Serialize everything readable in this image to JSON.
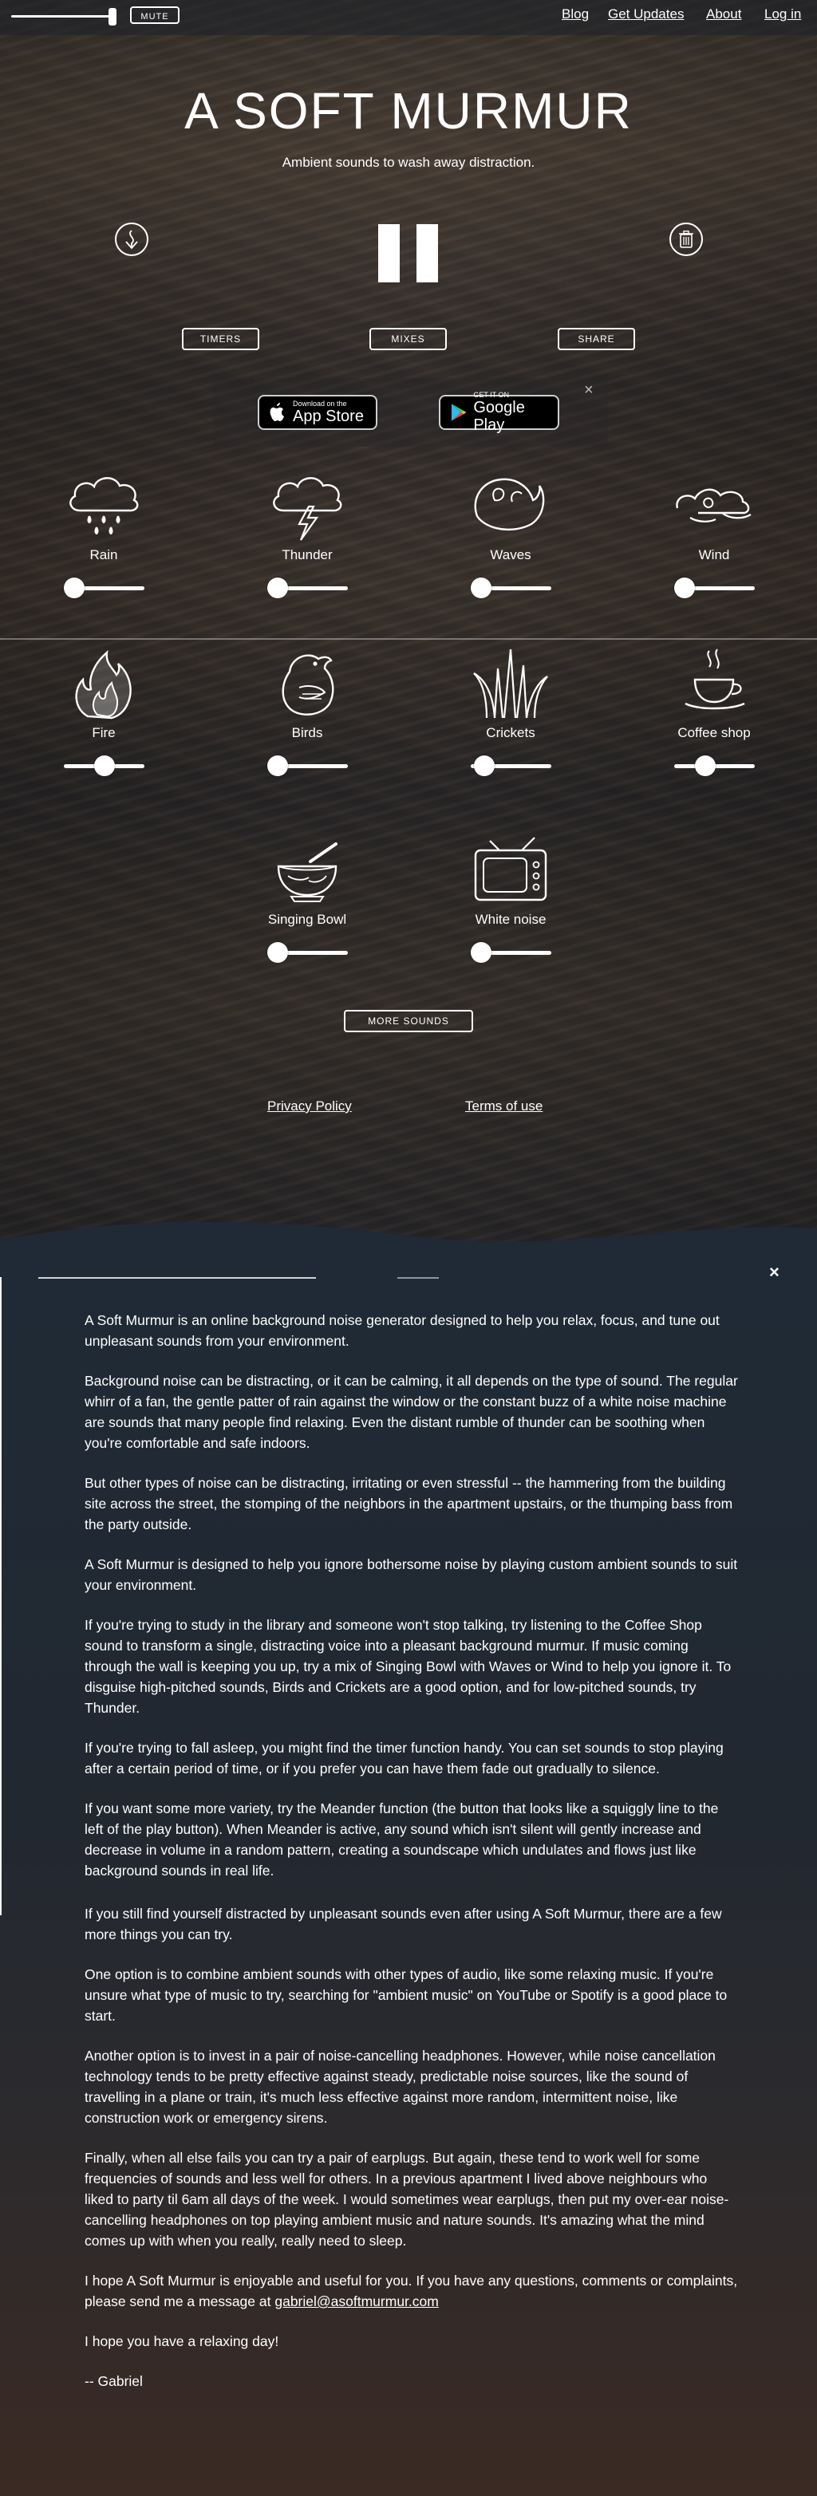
{
  "topbar": {
    "mute_label": "MUTE",
    "nav": [
      "Blog",
      "Get Updates",
      "About",
      "Log in"
    ]
  },
  "hero": {
    "title": "A SOFT MURMUR",
    "subtitle": "Ambient sounds to wash away distraction."
  },
  "controls": {
    "left_icon": "meander-icon",
    "play_state_icon": "pause-icon",
    "right_icon": "trash-icon",
    "buttons": [
      "TIMERS",
      "MIXES",
      "SHARE"
    ]
  },
  "stores": {
    "apple_small": "Download on the",
    "apple_big": "App Store",
    "google_small": "GET IT ON",
    "google_big": "Google Play",
    "close": "×"
  },
  "sounds": [
    {
      "label": "Rain",
      "icon": "rain-cloud-icon",
      "level": 0.0
    },
    {
      "label": "Thunder",
      "icon": "thunder-cloud-icon",
      "level": 0.0
    },
    {
      "label": "Waves",
      "icon": "waves-icon",
      "level": 0.0
    },
    {
      "label": "Wind",
      "icon": "wind-icon",
      "level": 0.0
    },
    {
      "label": "Fire",
      "icon": "fire-icon",
      "level": 0.5
    },
    {
      "label": "Birds",
      "icon": "bird-icon",
      "level": 0.0
    },
    {
      "label": "Crickets",
      "icon": "grass-icon",
      "level": 0.05
    },
    {
      "label": "Coffee shop",
      "icon": "coffee-cup-icon",
      "level": 0.35
    },
    {
      "label": "Singing Bowl",
      "icon": "singing-bowl-icon",
      "level": 0.0
    },
    {
      "label": "White noise",
      "icon": "tv-icon",
      "level": 0.0
    }
  ],
  "more_sounds": "MORE SOUNDS",
  "footer_links": [
    "Privacy Policy",
    "Terms of use"
  ],
  "article": {
    "close": "×",
    "paragraphs": [
      "A Soft Murmur is an online background noise generator designed to help you relax, focus, and tune out unpleasant sounds from your environment.",
      "Background noise can be distracting, or it can be calming, it all depends on the type of sound. The regular whirr of a fan, the gentle patter of rain against the window or the constant buzz of a white noise machine are sounds that many people find relaxing. Even the distant rumble of thunder can be soothing when you're comfortable and safe indoors.",
      "But other types of noise can be distracting, irritating or even stressful -- the hammering from the building site across the street, the stomping of the neighbors in the apartment upstairs, or the thumping bass from the party outside.",
      "A Soft Murmur is designed to help you ignore bothersome noise by playing custom ambient sounds to suit your environment.",
      "If you're trying to study in the library and someone won't stop talking, try listening to the Coffee Shop sound to transform a single, distracting voice into a pleasant background murmur. If music coming through the wall is keeping you up, try a mix of Singing Bowl with Waves or Wind to help you ignore it. To disguise high-pitched sounds, Birds and Crickets are a good option, and for low-pitched sounds, try Thunder.",
      "If you're trying to fall asleep, you might find the timer function handy. You can set sounds to stop playing after a certain period of time, or if you prefer you can have them fade out gradually to silence.",
      "If you want some more variety, try the Meander function (the button that looks like a squiggly line to the left of the play button). When Meander is active, any sound which isn't silent will gently increase and decrease in volume in a random pattern, creating a soundscape which undulates and flows just like background sounds in real life.",
      "If you still find yourself distracted by unpleasant sounds even after using A Soft Murmur, there are a few more things you can try.",
      "One option is to combine ambient sounds with other types of audio, like some relaxing music. If you're unsure what type of music to try, searching for \"ambient music\" on YouTube or Spotify is a good place to start.",
      "Another option is to invest in a pair of noise-cancelling headphones. However, while noise cancellation technology tends to be pretty effective against steady, predictable noise sources, like the sound of travelling in a plane or train, it's much less effective against more random, intermittent noise, like construction work or emergency sirens.",
      "Finally, when all else fails you can try a pair of earplugs. But again, these tend to work well for some frequencies of sounds and less well for others. In a previous apartment I lived above neighbours who liked to party til 6am all days of the week. I would sometimes wear earplugs, then put my over-ear noise-cancelling headphones on top playing ambient music and nature sounds. It's amazing what the mind comes up with when you really, really need to sleep."
    ],
    "contact_text": "I hope A Soft Murmur is enjoyable and useful for you. If you have any questions, comments or complaints, please send me a message at",
    "contact_email": "gabriel@asoftmurmur.com",
    "closing": "I hope you have a relaxing day!",
    "signature": "-- Gabriel"
  }
}
